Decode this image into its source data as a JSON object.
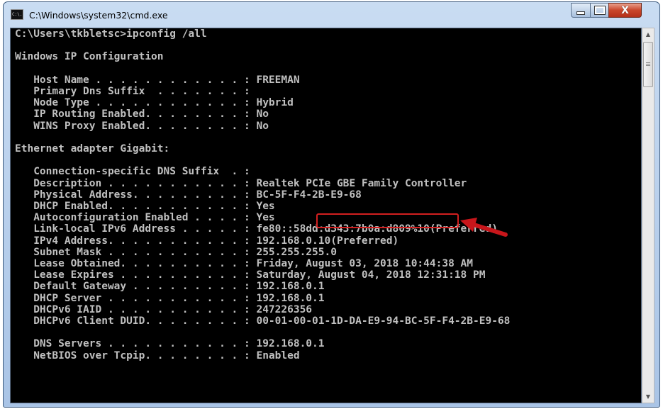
{
  "window": {
    "title": "C:\\Windows\\system32\\cmd.exe",
    "icon": "cmd-app-icon",
    "icon_text": "C:\\."
  },
  "controls": {
    "minimize": "minimize-icon",
    "maximize": "maximize-icon",
    "close": "close-icon",
    "close_glyph": "X"
  },
  "console": {
    "background": "#000000",
    "foreground": "#c0c0c0",
    "lines": [
      "C:\\Users\\tkbletsc>ipconfig /all",
      "",
      "Windows IP Configuration",
      "",
      "   Host Name . . . . . . . . . . . . : FREEMAN",
      "   Primary Dns Suffix  . . . . . . . :",
      "   Node Type . . . . . . . . . . . . : Hybrid",
      "   IP Routing Enabled. . . . . . . . : No",
      "   WINS Proxy Enabled. . . . . . . . : No",
      "",
      "Ethernet adapter Gigabit:",
      "",
      "   Connection-specific DNS Suffix  . :",
      "   Description . . . . . . . . . . . : Realtek PCIe GBE Family Controller",
      "   Physical Address. . . . . . . . . : BC-5F-F4-2B-E9-68",
      "   DHCP Enabled. . . . . . . . . . . : Yes",
      "   Autoconfiguration Enabled . . . . : Yes",
      "   Link-local IPv6 Address . . . . . : fe80::58dd:d343:7b0a:d809%10(Preferred)",
      "   IPv4 Address. . . . . . . . . . . : 192.168.0.10(Preferred)",
      "   Subnet Mask . . . . . . . . . . . : 255.255.255.0",
      "   Lease Obtained. . . . . . . . . . : Friday, August 03, 2018 10:44:38 AM",
      "   Lease Expires . . . . . . . . . . : Saturday, August 04, 2018 12:31:18 PM",
      "   Default Gateway . . . . . . . . . : 192.168.0.1",
      "   DHCP Server . . . . . . . . . . . : 192.168.0.1",
      "   DHCPv6 IAID . . . . . . . . . . . : 247226356",
      "   DHCPv6 Client DUID. . . . . . . . : 00-01-00-01-1D-DA-E9-94-BC-5F-F4-2B-E9-68",
      "",
      "   DNS Servers . . . . . . . . . . . : 192.168.0.1",
      "   NetBIOS over Tcpip. . . . . . . . : Enabled"
    ]
  },
  "annotation": {
    "highlight_color": "#d21f1f",
    "highlighted_value": "BC-5F-F4-2B-E9-68",
    "arrow": "red-arrow-icon"
  },
  "scrollbar": {
    "up": "scroll-up-arrow-icon",
    "down": "scroll-down-arrow-icon",
    "up_glyph": "▲",
    "down_glyph": "▼"
  }
}
